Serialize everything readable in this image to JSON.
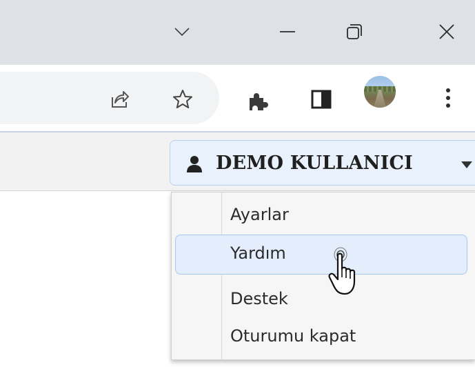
{
  "browser": {
    "titlebar": {
      "icons": {
        "tab_search": "chevron-down-icon",
        "minimize": "minimize-icon",
        "restore": "restore-icon",
        "close": "close-icon"
      }
    },
    "toolbar": {
      "icons": {
        "share": "share-icon",
        "bookmark": "star-icon",
        "extensions": "puzzle-icon",
        "side_panel": "side-panel-icon",
        "profile": "profile-avatar",
        "menu": "more-vert-icon"
      }
    }
  },
  "page": {
    "user_menu": {
      "icon": "user-icon",
      "label": "DEMO KULLANICI",
      "caret": "caret-down-icon",
      "items": [
        {
          "label": "Ayarlar"
        },
        {
          "label": "Yardım"
        },
        {
          "label": "Destek"
        },
        {
          "label": "Oturumu kapat"
        }
      ],
      "hovered_item": "Yardım"
    },
    "cursor": "hand-pointer-icon"
  },
  "colors": {
    "titlebar_bg": "#dee1e6",
    "omnibox_bg": "#f1f3f4",
    "user_button_bg": "#e8f1fc",
    "user_button_border": "#b8cfee",
    "menu_bg": "#f6f6f6",
    "menu_highlight_bg": "#e3edfb",
    "menu_highlight_border": "#a9c6ec"
  }
}
